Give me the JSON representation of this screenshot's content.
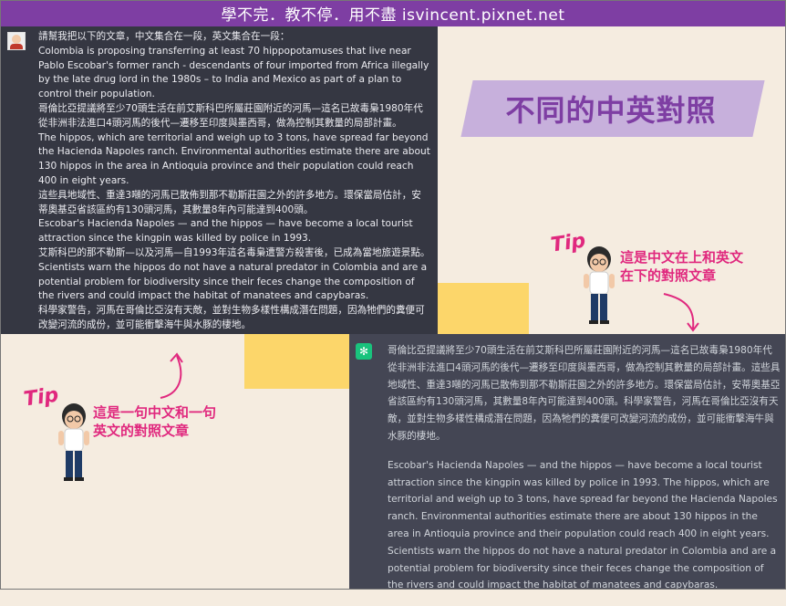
{
  "banner": {
    "text": "學不完．教不停．用不盡 isvincent.pixnet.net"
  },
  "user_message": {
    "avatar": "user-avatar",
    "paragraphs": [
      "請幫我把以下的文章，中文集合在一段，英文集合在一段：",
      "Colombia is proposing transferring at least 70 hippopotamuses that live near Pablo Escobar's former ranch - descendants of four imported from Africa illegally by the late drug lord in the 1980s – to India and Mexico as part of a plan to control their population.",
      "哥倫比亞提議將至少70頭生活在前艾斯科巴所屬莊園附近的河馬—這名已故毒梟1980年代從非洲非法進口4頭河馬的後代—遷移至印度與墨西哥，做為控制其數量的局部計畫。",
      "The hippos, which are territorial and weigh up to 3 tons, have spread far beyond the Hacienda Napoles ranch. Environmental authorities estimate there are about 130 hippos in the area in Antioquia province and their population could reach 400 in eight years.",
      "這些具地域性、重達3噸的河馬已散佈到那不勒斯莊園之外的許多地方。環保當局估計，安蒂奧基亞省該區約有130頭河馬，其數量8年內可能達到400頭。",
      "Escobar's Hacienda Napoles — and the hippos — have become a local tourist attraction since the kingpin was killed by police in 1993.",
      "艾斯科巴的那不勒斯—以及河馬—自1993年這名毒梟遭警方殺害後，已成為當地旅遊景點。",
      "Scientists warn the hippos do not have a natural predator in Colombia and are a potential problem for biodiversity since their feces change the composition of the rivers and could impact the habitat of manatees and capybaras.",
      "科學家警告，河馬在哥倫比亞沒有天敵，並對生物多樣性構成潛在問題，因為牠們的糞便可改變河流的成份，並可能衝擊海牛與水豚的棲地。"
    ]
  },
  "title_card": {
    "text": "不同的中英對照"
  },
  "tip_top": {
    "label": "Tip",
    "line1": "這是中文在上和英文",
    "line2": "在下的對照文章"
  },
  "tip_bottom": {
    "label": "Tip",
    "line1": "這是一句中文和一句",
    "line2": "英文的對照文章"
  },
  "bot_message": {
    "icon": "chatgpt-logo-icon",
    "paragraphs": [
      "哥倫比亞提議將至少70頭生活在前艾斯科巴所屬莊園附近的河馬—這名已故毒梟1980年代從非洲非法進口4頭河馬的後代—遷移至印度與墨西哥，做為控制其數量的局部計畫。這些具地域性、重達3噸的河馬已散佈到那不勒斯莊園之外的許多地方。環保當局估計，安蒂奧基亞省該區約有130頭河馬，其數量8年內可能達到400頭。科學家警告，河馬在哥倫比亞沒有天敵，並對生物多樣性構成潛在問題，因為牠們的糞便可改變河流的成份，並可能衝擊海牛與水豚的棲地。",
      "Escobar's Hacienda Napoles — and the hippos — have become a local tourist attraction since the kingpin was killed by police in 1993. The hippos, which are territorial and weigh up to 3 tons, have spread far beyond the Hacienda Napoles ranch. Environmental authorities estimate there are about 130 hippos in the area in Antioquia province and their population could reach 400 in eight years. Scientists warn the hippos do not have a natural predator in Colombia and are a potential problem for biodiversity since their feces change the composition of the rivers and could impact the habitat of manatees and capybaras."
    ]
  },
  "colors": {
    "banner": "#7e3ea3",
    "accent_pink": "#e0287e",
    "title_purple": "#7e3ea3",
    "yellow": "#fcd66a",
    "user_bg": "#353742",
    "bot_bg": "#444654"
  }
}
